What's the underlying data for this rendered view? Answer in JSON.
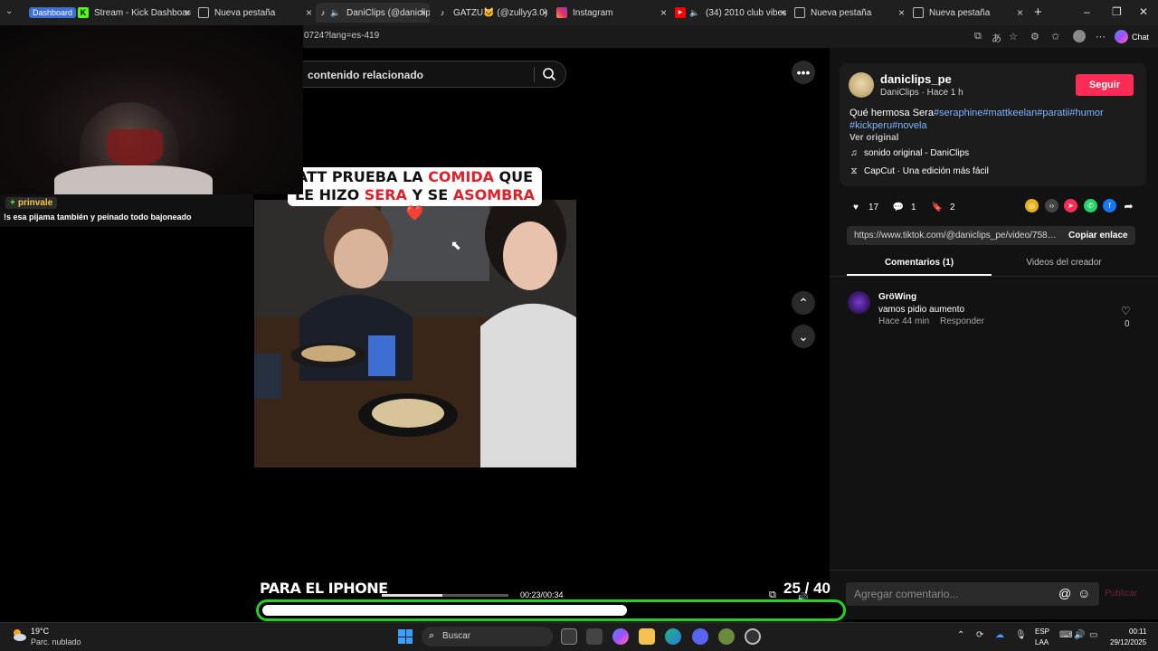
{
  "browser": {
    "tab_group_label": "Dashboard",
    "tabs": [
      {
        "label": "Stream - Kick Dashboard",
        "icon": "kick-icon",
        "active": false
      },
      {
        "label": "Nueva pestaña",
        "icon": "page-icon",
        "active": false
      },
      {
        "label": "DaniClips (@daniclip",
        "icon": "tiktok-icon",
        "active": true
      },
      {
        "label": "GATZU🐱 (@zullyy3.0) es",
        "icon": "tiktok-icon",
        "active": false
      },
      {
        "label": "Instagram",
        "icon": "instagram-icon",
        "active": false
      },
      {
        "label": "(34) 2010 club vibes -",
        "icon": "youtube-icon",
        "active": false
      },
      {
        "label": "Nueva pestaña",
        "icon": "page-icon",
        "active": false
      },
      {
        "label": "Nueva pestaña",
        "icon": "page-icon",
        "active": false
      }
    ],
    "url": "0724?lang=es-419",
    "chat_label": "Chat"
  },
  "stream_overlay": {
    "chat_username": "prinvale",
    "chat_message": "!s esa pijama también y peinado todo bajoneado"
  },
  "video": {
    "search_placeholder": "contenido relacionado",
    "caption_line1_parts": [
      "ATT PRUEBA LA ",
      "COMIDA",
      " QUE"
    ],
    "caption_line2_parts": [
      "LE HIZO ",
      "SERA",
      " Y SE ",
      "ASOMBRA",
      "❤️"
    ],
    "bottom_text": "PARA EL IPHONE",
    "time": "00:23/00:34",
    "progress": 0.48,
    "page_counter": "25 / 40",
    "overlay_progress": 0.63
  },
  "post": {
    "username": "daniclips_pe",
    "subtitle": "DaniClips · Hace 1 h",
    "follow_label": "Seguir",
    "description_text": "Qué hermosa Sera",
    "description_tags_line1": "#seraphine#mattkeelan#paratii#humor",
    "description_tags_line2": "#kickperu#novela",
    "see_original": "Ver original",
    "sound": "sonido original - DaniClips",
    "capcut": "CapCut · Una edición más fácil",
    "likes": "17",
    "comments_count": "1",
    "saves": "2",
    "link": "https://www.tiktok.com/@daniclips_pe/video/7589...",
    "copy_link_label": "Copiar enlace",
    "tab_comments": "Comentarios (1)",
    "tab_creator_videos": "Videos del creador"
  },
  "comment": {
    "user": "GröWing",
    "text": "vamos pidio aumento",
    "time": "Hace 44 min",
    "reply_label": "Responder",
    "like_count": "0"
  },
  "comment_input": {
    "placeholder": "Agregar comentario...",
    "post_label": "Publicar"
  },
  "taskbar": {
    "temperature": "19°C",
    "weather": "Parc. nublado",
    "search_label": "Buscar",
    "lang1": "ESP",
    "lang2": "LAA",
    "time": "00:11",
    "date": "29/12/2025"
  },
  "colors": {
    "accent_pink": "#fe2c55",
    "tag_blue": "#7fb2ff",
    "overlay_green": "#1ed41e"
  }
}
